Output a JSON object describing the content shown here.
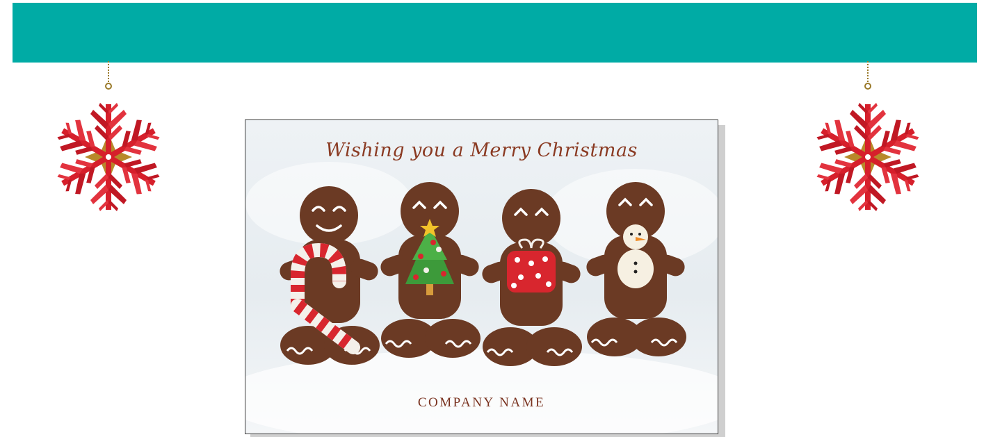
{
  "banner": {
    "color": "#00aba5"
  },
  "ornaments": {
    "left": {
      "icon": "snowflake-ornament-icon",
      "primary_color": "#d61f2b",
      "accent_color": "#b8892a"
    },
    "right": {
      "icon": "snowflake-ornament-icon",
      "primary_color": "#d61f2b",
      "accent_color": "#b8892a"
    }
  },
  "card": {
    "greeting": "Wishing you a Merry Christmas",
    "company_name": "COMPANY NAME",
    "text_color": "#8a3a22",
    "background_color": "#e9eef2",
    "cookies": [
      {
        "icon": "gingerbread-candy-cane-icon"
      },
      {
        "icon": "gingerbread-christmas-tree-icon"
      },
      {
        "icon": "gingerbread-gift-icon"
      },
      {
        "icon": "gingerbread-snowman-icon"
      }
    ]
  }
}
